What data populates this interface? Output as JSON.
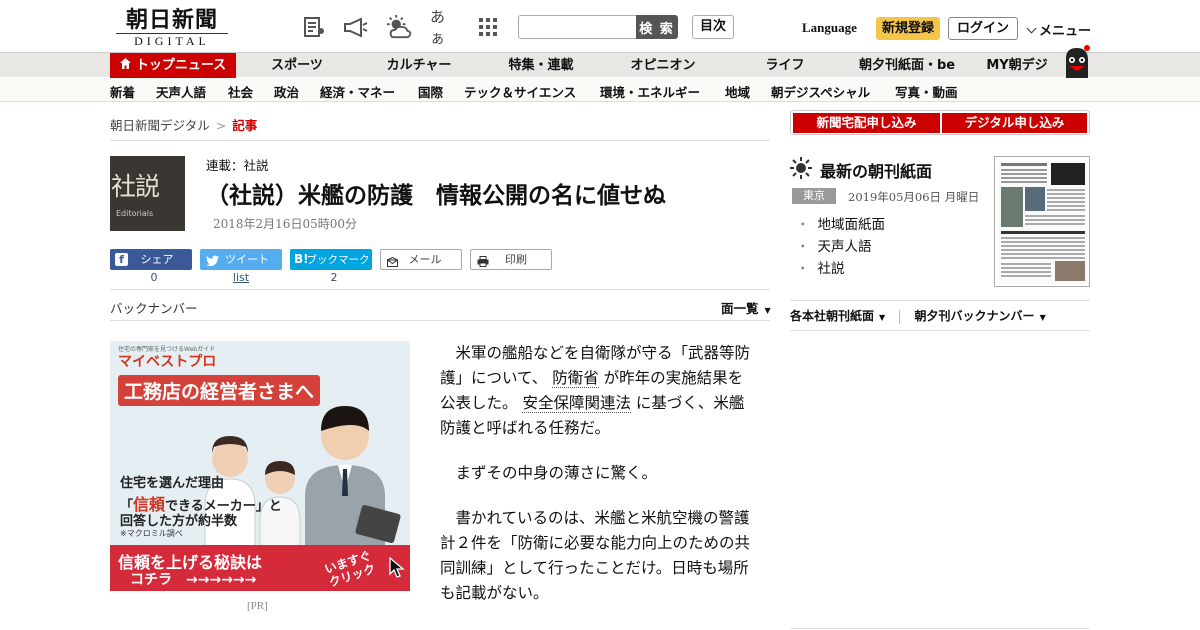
{
  "header": {
    "logo_jp": "朝日新聞",
    "logo_en": "DIGITAL",
    "icons": [
      "newspaper-icon",
      "megaphone-icon",
      "weather-icon",
      "font-size-icon",
      "grid-menu-icon"
    ],
    "font_icon_text": "あぁ",
    "search_placeholder": "",
    "search_button": "検 索",
    "toc_button": "目次",
    "language": "Language",
    "register": "新規登録",
    "login": "ログイン",
    "menu": "メニュー"
  },
  "nav_primary": [
    {
      "label": "トップニュース",
      "active": true
    },
    {
      "label": "スポーツ"
    },
    {
      "label": "カルチャー"
    },
    {
      "label": "特集・連載"
    },
    {
      "label": "オピニオン"
    },
    {
      "label": "ライフ"
    },
    {
      "label": "朝夕刊紙面・be"
    },
    {
      "label": "MY朝デジ"
    }
  ],
  "nav_secondary": [
    "新着",
    "天声人語",
    "社会",
    "政治",
    "経済・マネー",
    "国際",
    "テック＆サイエンス",
    "環境・エネルギー",
    "地域",
    "朝デジスペシャル",
    "写真・動画"
  ],
  "breadcrumb": {
    "home": "朝日新聞デジタル",
    "separator": ">",
    "current": "記事"
  },
  "article": {
    "thumb_kanji": "社説",
    "thumb_en": "Editorials",
    "series": "連載：社説",
    "title": "（社説）米艦の防護　情報公開の名に値せぬ",
    "date": "2018年2月16日05時00分",
    "paragraphs": [
      {
        "a": "米軍の艦船などを自衛隊が守る「武器等防護」について、",
        "l1": "防衛省",
        "b": "が昨年の実施結果を公表した。",
        "l2": "安全保障関連法",
        "c": "に基づく、米艦防護と呼ばれる任務だ。"
      },
      {
        "a": "まずその中身の薄さに驚く。"
      },
      {
        "a": "書かれているのは、米艦と米航空機の警護計２件を「防衛に必要な能力向上のための共同訓練」として行ったことだけ。日時も場所も記載がない。"
      }
    ]
  },
  "share": {
    "facebook": {
      "label": "シェア",
      "count": "0"
    },
    "twitter": {
      "label": "ツイート",
      "count": "list"
    },
    "hatena": {
      "label": "ブックマーク",
      "badge": "B!",
      "count": "2"
    },
    "mail": {
      "label": "メール"
    },
    "print": {
      "label": "印刷"
    }
  },
  "back_number": "バックナンバー",
  "page_list": "面一覧",
  "ad": {
    "brand": "マイベストプロ",
    "tagline": "住宅の専門家を見つけるWebガイド",
    "headline": "工務店の経営者さまへ",
    "text1": "住宅を選んだ理由",
    "text2_pre": "「",
    "text2_red": "信頼",
    "text2_post": "できるメーカー」と",
    "text3": "回答した方が約半数",
    "text4": "※マクロミル調べ",
    "cta1": "信頼を上げる秘訣は",
    "cta2": "コチラ　→→→→→→",
    "cta3": "いますぐ",
    "cta4": "クリック",
    "pr": "[PR]"
  },
  "sidebar": {
    "subscribe_paper": "新聞宅配申し込み",
    "subscribe_digital": "デジタル申し込み",
    "latest_title": "最新の朝刊紙面",
    "region": "東京",
    "paper_date": "2019年05月06日 月曜日",
    "links": [
      "地域面紙面",
      "天声人語",
      "社説"
    ],
    "bullet": "・",
    "bottom_links": [
      "各本社朝刊紙面",
      "朝夕刊バックナンバー"
    ]
  },
  "colors": {
    "accent": "#cc0000",
    "register": "#f5c54a",
    "facebook": "#3b5998",
    "twitter": "#55acee",
    "hatena": "#00a4de"
  }
}
